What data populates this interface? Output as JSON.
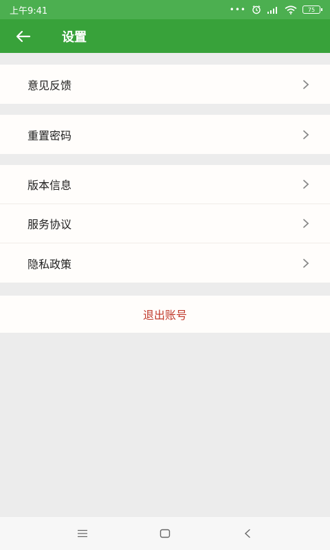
{
  "status_bar": {
    "time": "上午9:41",
    "dots": "•••",
    "battery": "75"
  },
  "app_bar": {
    "title": "设置"
  },
  "groups": [
    {
      "items": [
        {
          "label": "意见反馈"
        }
      ]
    },
    {
      "items": [
        {
          "label": "重置密码"
        }
      ]
    },
    {
      "items": [
        {
          "label": "版本信息"
        },
        {
          "label": "服务协议"
        },
        {
          "label": "隐私政策"
        }
      ]
    }
  ],
  "logout": {
    "label": "退出账号"
  },
  "colors": {
    "status_bar": "#4caf50",
    "app_bar": "#38a23a",
    "logout_text": "#c0392b",
    "background": "#ececec"
  },
  "icons": {
    "back": "arrow-left-icon",
    "chevron": "chevron-right-icon",
    "nav_menu": "menu-icon",
    "nav_home": "home-icon",
    "nav_back": "back-icon"
  }
}
